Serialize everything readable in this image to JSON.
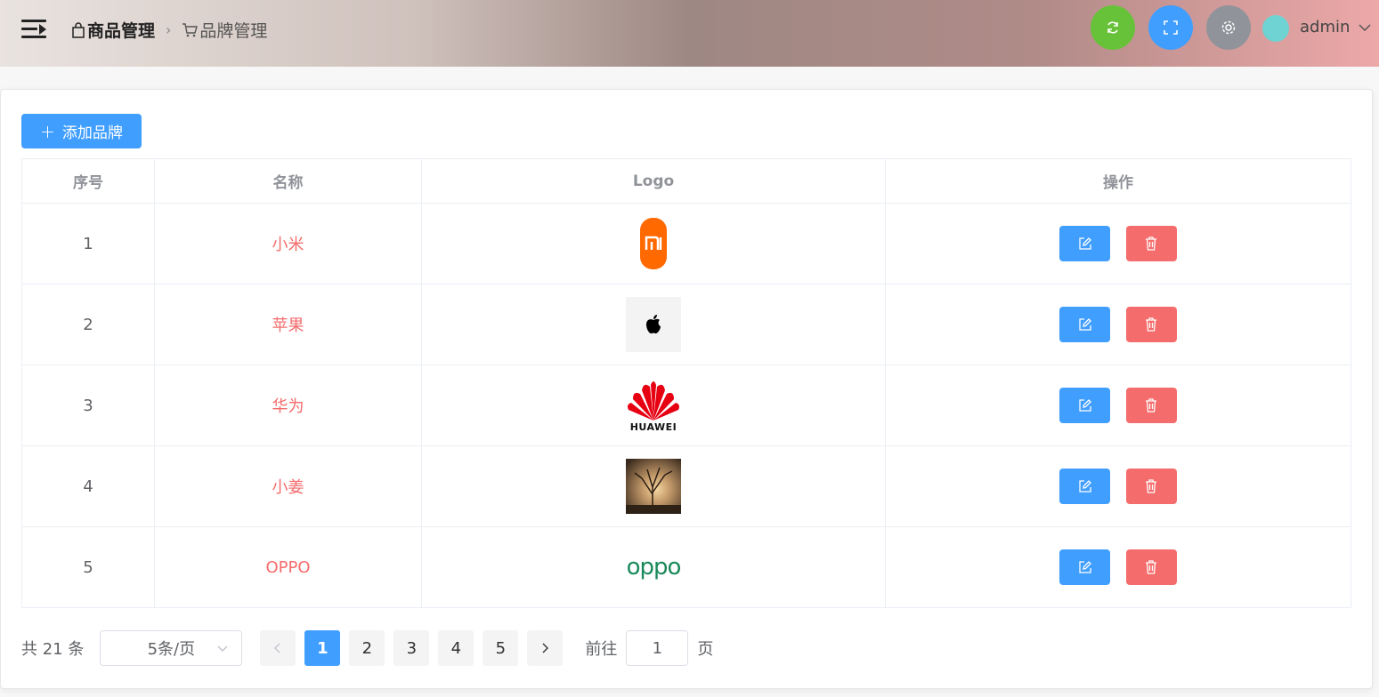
{
  "header": {
    "breadcrumb": [
      {
        "label": "商品管理"
      },
      {
        "label": "品牌管理"
      }
    ],
    "user": "admin"
  },
  "toolbar": {
    "add_label": "添加品牌"
  },
  "table": {
    "columns": [
      "序号",
      "名称",
      "Logo",
      "操作"
    ],
    "rows": [
      {
        "index": "1",
        "name": "小米",
        "logo": "xiaomi-logo"
      },
      {
        "index": "2",
        "name": "苹果",
        "logo": "apple-logo"
      },
      {
        "index": "3",
        "name": "华为",
        "logo": "huawei-logo"
      },
      {
        "index": "4",
        "name": "小姜",
        "logo": "photo-tree-sunset"
      },
      {
        "index": "5",
        "name": "OPPO",
        "logo": "oppo-logo"
      }
    ]
  },
  "huawei_text": "HUAWEI",
  "oppo_text": "oppo",
  "pagination": {
    "total_text": "共 21 条",
    "page_size": "5条/页",
    "pages": [
      "1",
      "2",
      "3",
      "4",
      "5"
    ],
    "current": "1",
    "goto_label": "前往",
    "goto_value": "1",
    "page_suffix": "页"
  },
  "colors": {
    "primary": "#409eff",
    "danger": "#f56c6c",
    "success": "#67c23a",
    "info": "#909399"
  }
}
